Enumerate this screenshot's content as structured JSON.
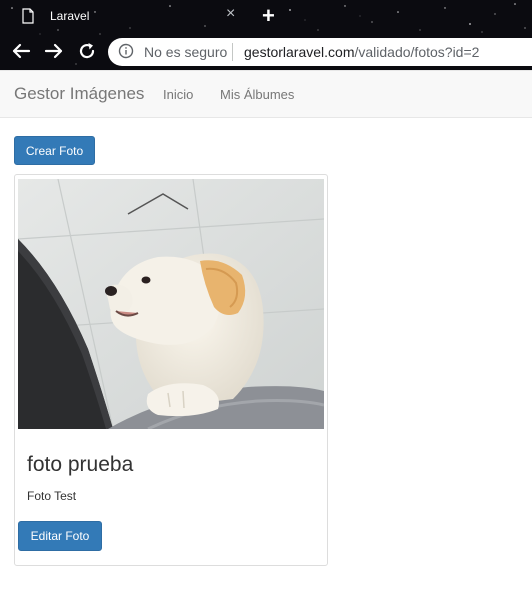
{
  "browser": {
    "tab_title": "Laravel",
    "security_label": "No es seguro",
    "url_host": "gestorlaravel.com",
    "url_path": "/validado/fotos?id=2"
  },
  "navbar": {
    "brand": "Gestor Imágenes",
    "links": [
      "Inicio",
      "Mis Álbumes"
    ]
  },
  "main": {
    "create_button": "Crear Foto",
    "photos": [
      {
        "title": "foto prueba",
        "description": "Foto Test",
        "edit_button": "Editar Foto",
        "image_icon": "puppy-photo"
      }
    ]
  },
  "colors": {
    "primary": "#337ab7",
    "navbar_bg": "#f8f8f8",
    "chrome_bg": "#0b0b10"
  }
}
